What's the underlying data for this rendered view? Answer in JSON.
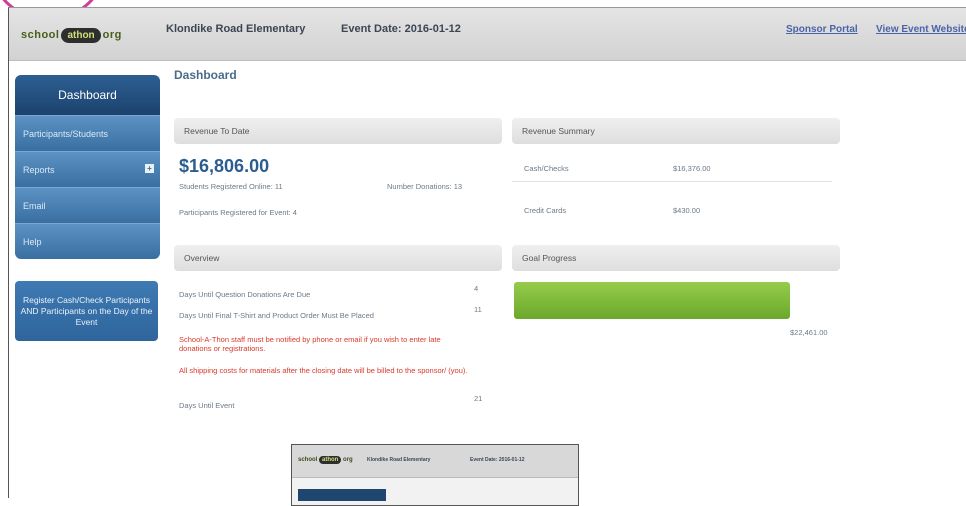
{
  "header": {
    "logo_left": "school",
    "logo_mid": "athon",
    "logo_right": "org",
    "school_name": "Klondike Road Elementary",
    "event_date": "Event Date: 2016-01-12",
    "sponsor_portal": "Sponsor Portal",
    "view_event_website": "View Event Website"
  },
  "sidebar": {
    "dashboard": "Dashboard",
    "items": [
      {
        "label": "Participants/Students"
      },
      {
        "label": "Reports"
      },
      {
        "label": "Email"
      },
      {
        "label": "Help"
      }
    ],
    "register_button": "Register Cash/Check Participants AND Participants on the Day of the Event"
  },
  "main": {
    "page_title": "Dashboard",
    "revenue_to_date": {
      "title": "Revenue To Date",
      "amount": "$16,806.00",
      "students_registered": "Students Registered Online: 11",
      "number_donations": "Number Donations: 13",
      "participants_registered": "Participants Registered for Event: 4"
    },
    "revenue_summary": {
      "title": "Revenue Summary",
      "rows": [
        {
          "label": "Cash/Checks",
          "value": "$16,376.00"
        },
        {
          "label": "Credit Cards",
          "value": "$430.00"
        }
      ]
    },
    "overview": {
      "title": "Overview",
      "donation_days_label": "Days Until Question Donations Are Due",
      "donation_days_value": "4",
      "tshirt_days_label": "Days Until Final T-Shirt and Product Order Must Be Placed",
      "tshirt_days_value": "11",
      "note_1": "School-A-Thon staff must be notified by phone or email if you wish to enter late donations or registrations.",
      "note_2": "All shipping costs for materials after the closing date will be billed to the sponsor/ (you).",
      "event_days_label": "Days Until Event",
      "event_days_value": "21"
    },
    "goal_progress": {
      "title": "Goal Progress",
      "goal_amount": "$22,461.00",
      "progress_fraction": 0.75
    }
  },
  "thumbnail": {
    "school_name": "Klondike Road Elementary",
    "event_date": "Event Date: 2016-01-12"
  }
}
